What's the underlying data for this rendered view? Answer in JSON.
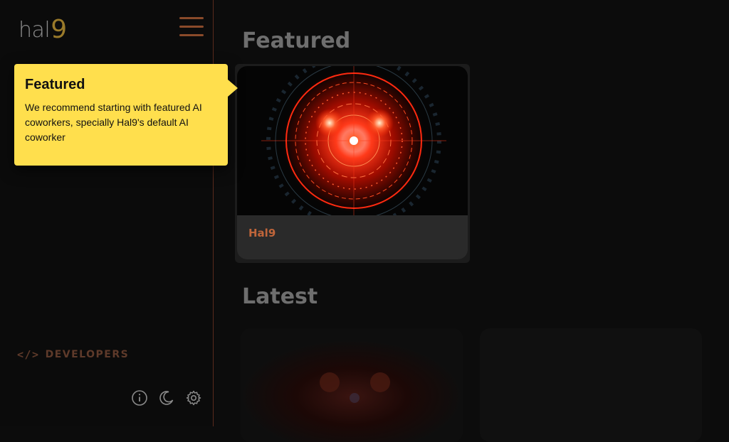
{
  "sidebar": {
    "logo": {
      "text": "hal",
      "accent": "9"
    },
    "menu_icon": "hamburger-menu-icon",
    "developers": {
      "icon": "</>",
      "label": "DEVELOPERS"
    },
    "footer_icons": [
      "info-icon",
      "moon-icon",
      "gear-icon"
    ]
  },
  "main": {
    "featured_title": "Featured",
    "latest_title": "Latest",
    "featured_card": {
      "name": "Hal9"
    }
  },
  "tooltip": {
    "title": "Featured",
    "body": "We recommend starting with featured AI coworkers, specially Hal9's default AI coworker"
  },
  "colors": {
    "accent": "#c0653a",
    "tooltip_bg": "#ffdf4d",
    "background": "#0c0c0c"
  }
}
